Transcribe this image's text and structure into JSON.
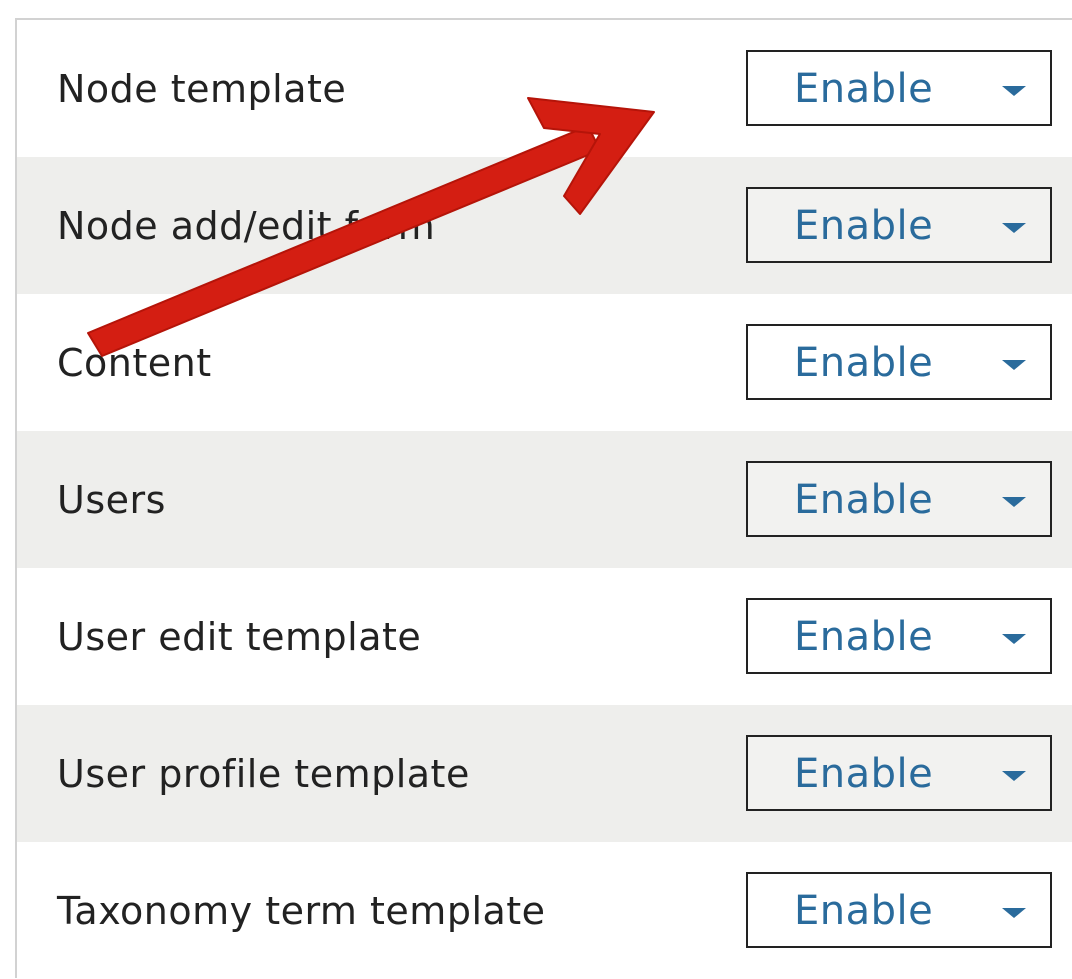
{
  "settings": {
    "rows": [
      {
        "label": "Node template",
        "value": "Enable"
      },
      {
        "label": "Node add/edit form",
        "value": "Enable"
      },
      {
        "label": "Content",
        "value": "Enable"
      },
      {
        "label": "Users",
        "value": "Enable"
      },
      {
        "label": "User edit template",
        "value": "Enable"
      },
      {
        "label": "User profile template",
        "value": "Enable"
      },
      {
        "label": "Taxonomy term template",
        "value": "Enable"
      }
    ]
  },
  "annotation": {
    "arrow_color": "#d41e12",
    "icon": "red-arrow-annotation"
  },
  "colors": {
    "select_text": "#2a6b9c",
    "row_alt_bg": "#eeeeec"
  }
}
